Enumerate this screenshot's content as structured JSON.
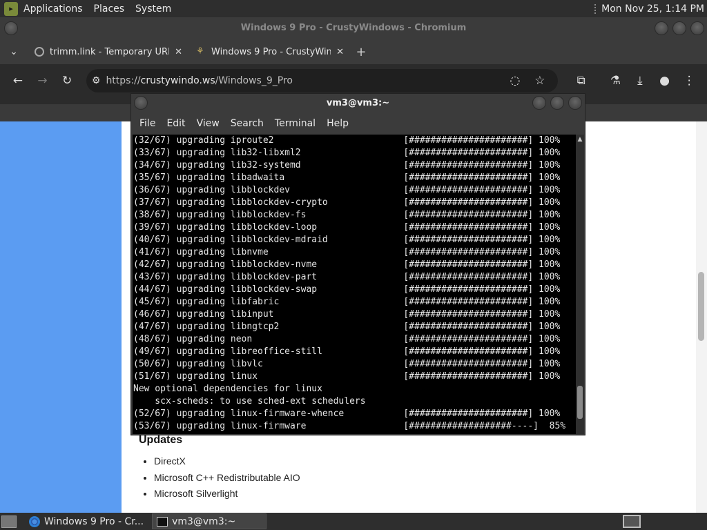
{
  "top_panel": {
    "menus": [
      "Applications",
      "Places",
      "System"
    ],
    "datetime": "Mon Nov 25, 1:14 PM"
  },
  "browser": {
    "window_title": "Windows 9 Pro - CrustyWindows - Chromium",
    "tabs": [
      {
        "title": "trimm.link - Temporary URL",
        "close": "✕"
      },
      {
        "title": "Windows 9 Pro - CrustyWindows",
        "close": "✕"
      }
    ],
    "new_tab": "+",
    "url_prefix": "https://",
    "url_host": "crustywindo.ws",
    "url_path": "/Windows_9_Pro"
  },
  "page": {
    "updates_heading": "Updates",
    "updates_items": [
      "DirectX",
      "Microsoft C++ Redistributable AIO",
      "Microsoft Silverlight"
    ]
  },
  "terminal": {
    "title": "vm3@vm3:~",
    "menu": [
      "File",
      "Edit",
      "View",
      "Search",
      "Terminal",
      "Help"
    ],
    "lines": [
      "(32/67) upgrading iproute2                        [######################] 100%",
      "(33/67) upgrading lib32-libxml2                   [######################] 100%",
      "(34/67) upgrading lib32-systemd                   [######################] 100%",
      "(35/67) upgrading libadwaita                      [######################] 100%",
      "(36/67) upgrading libblockdev                     [######################] 100%",
      "(37/67) upgrading libblockdev-crypto              [######################] 100%",
      "(38/67) upgrading libblockdev-fs                  [######################] 100%",
      "(39/67) upgrading libblockdev-loop                [######################] 100%",
      "(40/67) upgrading libblockdev-mdraid              [######################] 100%",
      "(41/67) upgrading libnvme                         [######################] 100%",
      "(42/67) upgrading libblockdev-nvme                [######################] 100%",
      "(43/67) upgrading libblockdev-part                [######################] 100%",
      "(44/67) upgrading libblockdev-swap                [######################] 100%",
      "(45/67) upgrading libfabric                       [######################] 100%",
      "(46/67) upgrading libinput                        [######################] 100%",
      "(47/67) upgrading libngtcp2                       [######################] 100%",
      "(48/67) upgrading neon                            [######################] 100%",
      "(49/67) upgrading libreoffice-still               [######################] 100%",
      "(50/67) upgrading libvlc                          [######################] 100%",
      "(51/67) upgrading linux                           [######################] 100%",
      "New optional dependencies for linux",
      "    scx-scheds: to use sched-ext schedulers",
      "(52/67) upgrading linux-firmware-whence           [######################] 100%",
      "(53/67) upgrading linux-firmware                  [###################----]  85%"
    ]
  },
  "taskbar": {
    "tasks": [
      "Windows 9 Pro - Cr...",
      "vm3@vm3:~"
    ]
  },
  "colors": {
    "page_left_panel": "#5b9cf2",
    "terminal_bg": "#000000",
    "panel_bg": "#2e2e2e"
  }
}
